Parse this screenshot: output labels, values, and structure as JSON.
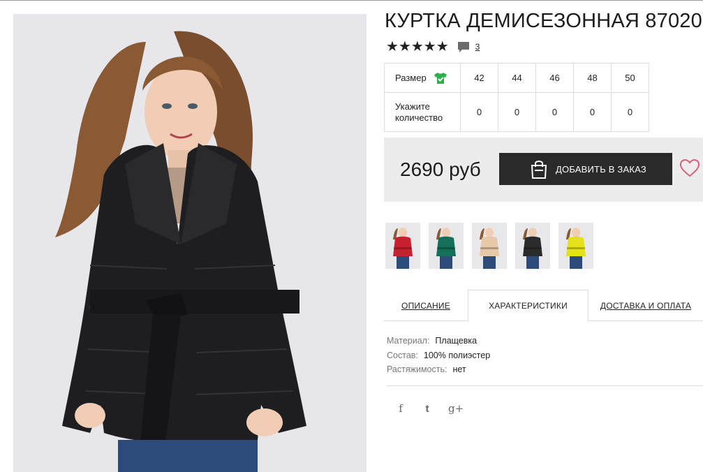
{
  "product": {
    "title": "КУРТКА ДЕМИСЕЗОННАЯ 87020",
    "stars": "★★★★★",
    "rating": 5,
    "review_count": "3"
  },
  "sizes": {
    "size_label": "Размер",
    "qty_label": "Укажите количество",
    "values": [
      "42",
      "44",
      "46",
      "48",
      "50"
    ],
    "quantities": [
      "0",
      "0",
      "0",
      "0",
      "0"
    ]
  },
  "price": {
    "text": "2690 руб",
    "order_button": "ДОБАВИТЬ В ЗАКАЗ"
  },
  "thumbnails": [
    {
      "name": "red",
      "color": "#c8202e"
    },
    {
      "name": "green",
      "color": "#15705a"
    },
    {
      "name": "beige",
      "color": "#e6c9a8"
    },
    {
      "name": "black",
      "color": "#2b2b2b"
    },
    {
      "name": "yellow",
      "color": "#e6e21a"
    }
  ],
  "tabs": [
    "ОПИСАНИЕ",
    "ХАРАКТЕРИСТИКИ",
    "ДОСТАВКА И ОПЛАТА"
  ],
  "specs": [
    {
      "key": "Материал:",
      "value": "Плащевка"
    },
    {
      "key": "Состав:",
      "value": "100% полиэстер"
    },
    {
      "key": "Растяжимость:",
      "value": "нет"
    }
  ],
  "social": {
    "facebook": "f",
    "twitter": "t",
    "googleplus": "g+"
  },
  "colors": {
    "accent_dark": "#2a2a2a",
    "size_icon_green": "#2bb24c",
    "heart": "#d9607a",
    "price_bg": "#ececec"
  }
}
